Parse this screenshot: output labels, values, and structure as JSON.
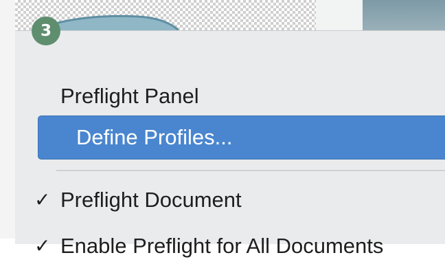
{
  "step_badge": "3",
  "menu": {
    "items": [
      {
        "label": "Preflight Panel",
        "checked": false,
        "highlighted": false
      },
      {
        "label": "Define Profiles...",
        "checked": false,
        "highlighted": true
      },
      {
        "label": "Preflight Document",
        "checked": true,
        "highlighted": false
      },
      {
        "label": "Enable Preflight for All Documents",
        "checked": true,
        "highlighted": false
      }
    ],
    "check_glyph": "✓"
  },
  "colors": {
    "highlight": "#4a86cf",
    "badge": "#5f8e6f",
    "menu_background": "#e9ebec"
  },
  "icons": [
    "checkmark-icon"
  ]
}
